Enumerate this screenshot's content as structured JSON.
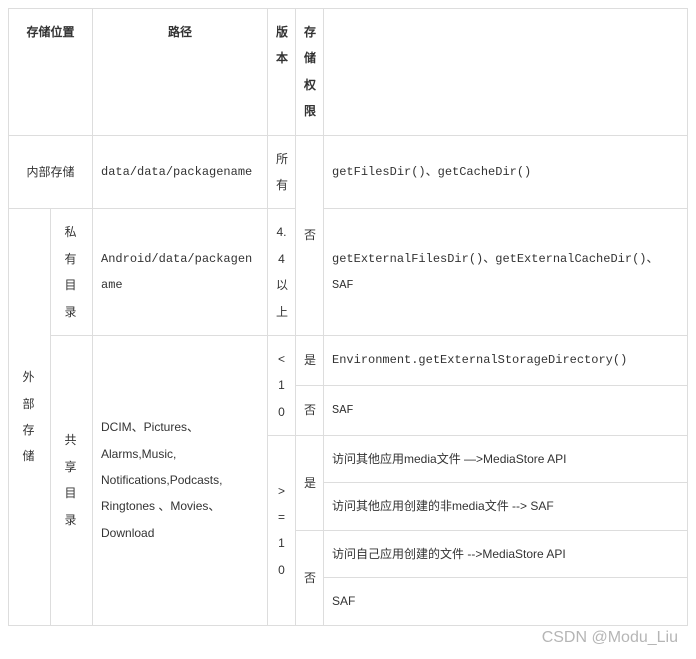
{
  "headers": {
    "location": "存储位置",
    "path": "路径",
    "version": "版本",
    "permission": "存储权限",
    "api": ""
  },
  "rows": {
    "internal": {
      "label": "内部存储",
      "path": "data/data/packagename",
      "version": "所有",
      "permission": "否",
      "api": "getFilesDir()、getCacheDir()"
    },
    "external": {
      "label": "外 部存储",
      "private": {
        "label": "私有目录",
        "path": "Android/data/packagename",
        "version": "4.4以上",
        "api": "getExternalFilesDir()、getExternalCacheDir()、SAF"
      },
      "shared": {
        "label": "共享目录",
        "path": "DCIM、Pictures、Alarms,Music, Notifications,Podcasts, Ringtones 、Movies、Download",
        "lt10": {
          "version": "< 1 0",
          "yes": {
            "permission": "是",
            "api": "Environment.getExternalStorageDirectory()"
          },
          "no": {
            "permission": "否",
            "api": "SAF"
          }
        },
        "ge10": {
          "version": "> = 1 0",
          "yes": {
            "permission": "是",
            "api1": "访问其他应用media文件 —>MediaStore API",
            "api2": "访问其他应用创建的非media文件 --> SAF"
          },
          "no": {
            "permission": "否",
            "api1": "访问自己应用创建的文件 -->MediaStore API",
            "api2": "SAF"
          }
        }
      }
    }
  },
  "watermark": "CSDN @Modu_Liu"
}
